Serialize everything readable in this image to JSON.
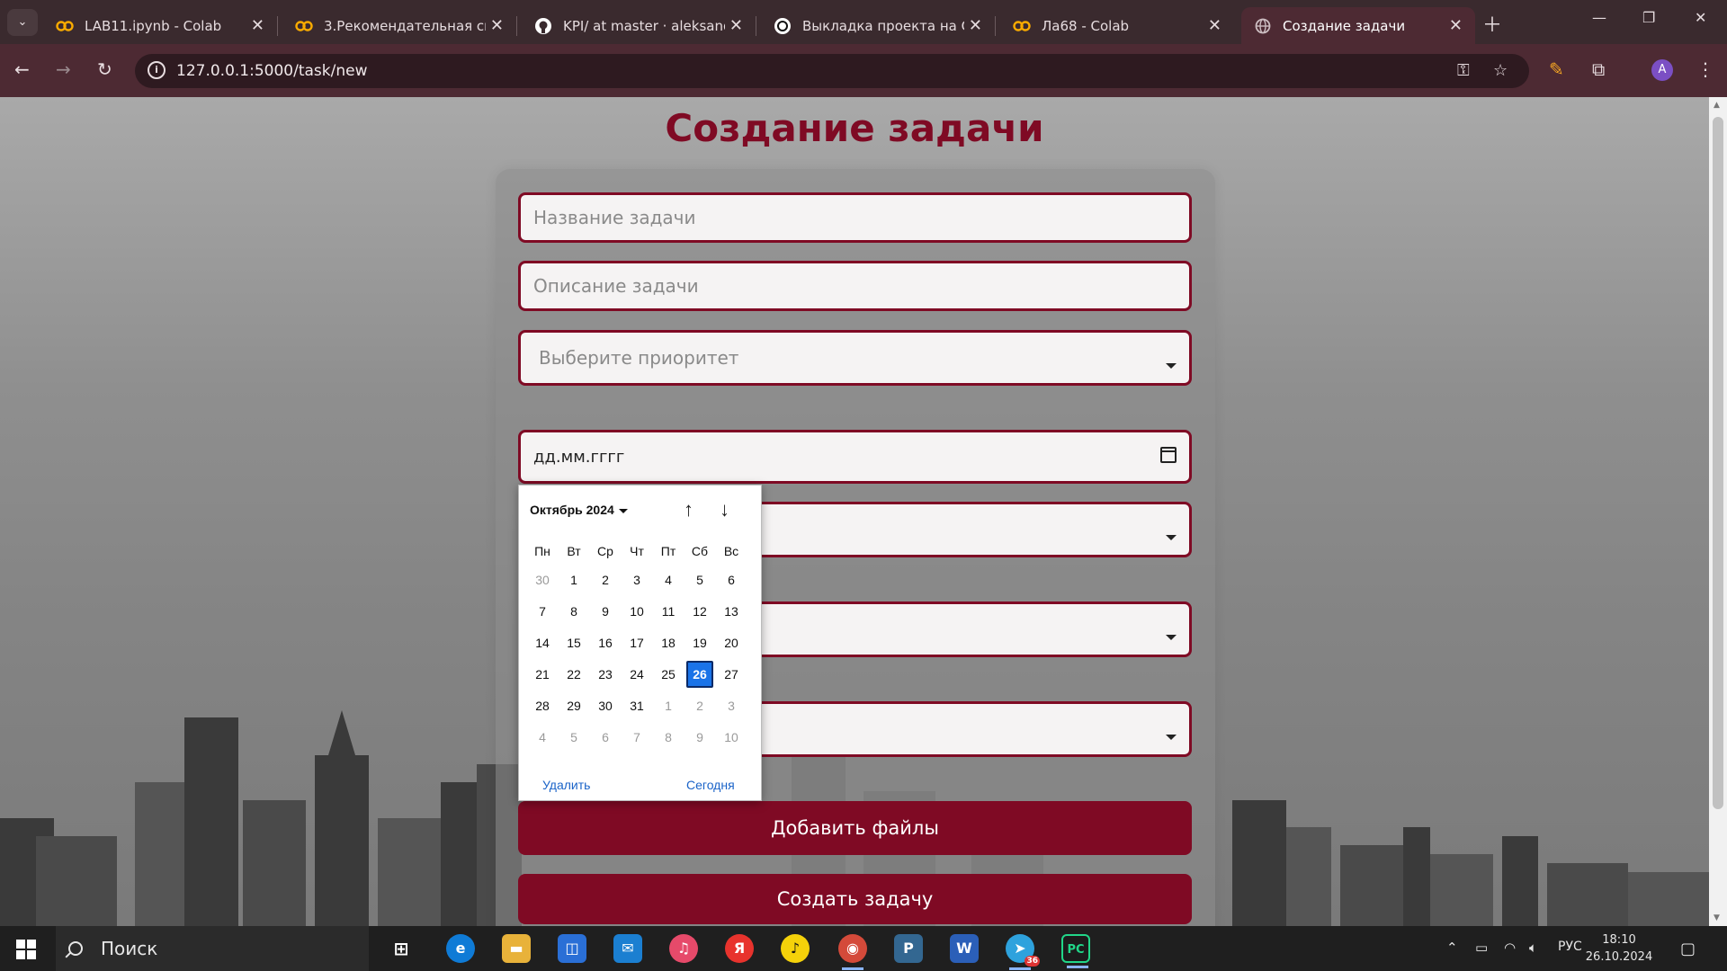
{
  "browser": {
    "tabs": [
      {
        "title": "LAB11.ipynb - Colab",
        "icon": "colab-icon"
      },
      {
        "title": "3.Рекомендательная систем",
        "icon": "colab-icon"
      },
      {
        "title": "KPI/ at master · aleksandrv",
        "icon": "github-icon"
      },
      {
        "title": "Выкладка проекта на GitHub",
        "icon": "chatgpt-icon"
      },
      {
        "title": "Ла68 - Colab",
        "icon": "colab-icon"
      },
      {
        "title": "Создание задачи",
        "icon": "globe-icon"
      }
    ],
    "url": "127.0.0.1:5000/task/new",
    "profile_initial": "A"
  },
  "page": {
    "title": "Создание задачи",
    "task_name_placeholder": "Название задачи",
    "task_description_placeholder": "Описание задачи",
    "priority_placeholder": "Выберите приоритет",
    "date_placeholder": "дд.мм.гггг",
    "add_files_label": "Добавить файлы",
    "create_task_label": "Создать задачу"
  },
  "datepicker": {
    "month_label": "Октябрь 2024",
    "weekdays": [
      "Пн",
      "Вт",
      "Ср",
      "Чт",
      "Пт",
      "Сб",
      "Вс"
    ],
    "weeks": [
      [
        "30",
        "1",
        "2",
        "3",
        "4",
        "5",
        "6"
      ],
      [
        "7",
        "8",
        "9",
        "10",
        "11",
        "12",
        "13"
      ],
      [
        "14",
        "15",
        "16",
        "17",
        "18",
        "19",
        "20"
      ],
      [
        "21",
        "22",
        "23",
        "24",
        "25",
        "26",
        "27"
      ],
      [
        "28",
        "29",
        "30",
        "31",
        "1",
        "2",
        "3"
      ],
      [
        "4",
        "5",
        "6",
        "7",
        "8",
        "9",
        "10"
      ]
    ],
    "selected_day": "26",
    "clear_label": "Удалить",
    "today_label": "Сегодня"
  },
  "taskbar": {
    "search_label": "Поиск",
    "language": "РУС",
    "time": "18:10",
    "date": "26.10.2024",
    "telegram_badge": "36"
  },
  "colors": {
    "accent": "#7f0a24",
    "selected": "#1a73e8"
  }
}
